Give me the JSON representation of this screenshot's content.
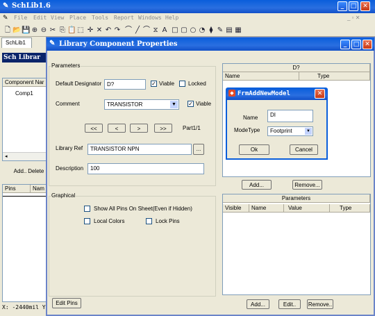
{
  "app": {
    "title": "SchLib1.6",
    "menu": [
      "File",
      "Edit",
      "View",
      "Place",
      "Tools",
      "Report",
      "Windows",
      "Help"
    ],
    "tab": "SchLib1",
    "tab_prefix": "Sch Librar",
    "component_header": "Component Nar",
    "component_item": "Comp1",
    "add_label": "Add..",
    "delete_label": "Delete I",
    "pins_col": "Pins",
    "name_col": "Nam",
    "status": "X: -2440mil Y:",
    "toolbar_icons": [
      "new-icon",
      "open-icon",
      "save-icon",
      "zoom-in-icon",
      "zoom-out-icon",
      "cut-icon",
      "copy-icon",
      "paste-icon",
      "select-icon",
      "move-icon",
      "cross-icon",
      "undo-icon",
      "redo-icon",
      "arc-icon",
      "line-icon",
      "bezier-icon",
      "polygon-icon",
      "text-icon",
      "rectangle-icon",
      "round-rect-icon",
      "ellipse-icon",
      "pie-icon",
      "pin-icon",
      "part-icon",
      "library-icon",
      "compile-icon"
    ],
    "toolbar_glyphs": [
      "🗋",
      "📂",
      "💾",
      "⊕",
      "⊖",
      "✂",
      "⎘",
      "📋",
      "⬚",
      "✛",
      "✕",
      "↶",
      "↷",
      "⌒",
      "╱",
      "⌒",
      "⧖",
      "A",
      "□",
      "▢",
      "○",
      "◔",
      "⧫",
      "✎",
      "▤",
      "▦"
    ]
  },
  "dialog": {
    "title": "Library Component Properties",
    "parameters_group": "Parameters",
    "default_designator_label": "Default  Designator",
    "default_designator_value": "D?",
    "visible1_label": "Viable",
    "locked_label": "Locked",
    "comment_label": "Comment",
    "comment_value": "TRANSISTOR",
    "visible2_label": "Viable",
    "nav_first": "<<",
    "nav_prev": "<",
    "nav_next": ">",
    "nav_last": ">>",
    "part_label": "Part1/1",
    "library_ref_label": "Library Ref",
    "library_ref_value": "TRANSISTOR NPN",
    "browse_label": "...",
    "description_label": "Description",
    "description_value": "100",
    "graphical_group": "Graphical",
    "show_all_pins_label": "Show All Pins On Sheet(Even if Hidden)",
    "local_colors_label": "Local Colors",
    "lock_pins_label": "Lock Pins",
    "edit_pins_label": "Edit Pins",
    "models_title": "D?",
    "models_name_col": "Name",
    "models_type_col": "Type",
    "models_add": "Add...",
    "models_remove": "Remove...",
    "params_title": "Parameters",
    "params_cols": [
      "Visible",
      "Name",
      "Value",
      "Type"
    ],
    "params_add": "Add...",
    "params_edit": "Edit..",
    "params_remove": "Remove.."
  },
  "popup": {
    "title": "FrmAddNewModel",
    "name_label": "Name",
    "name_value": "DI",
    "modetype_label": "ModeType",
    "modetype_value": "Footprint",
    "ok_label": "Ok",
    "cancel_label": "Cancel"
  },
  "colors": {
    "titlebar": "#0a5edb",
    "dialog_bg": "#ece9d8",
    "dialog_border": "#6b84c9",
    "close_red": "#d64a26"
  }
}
